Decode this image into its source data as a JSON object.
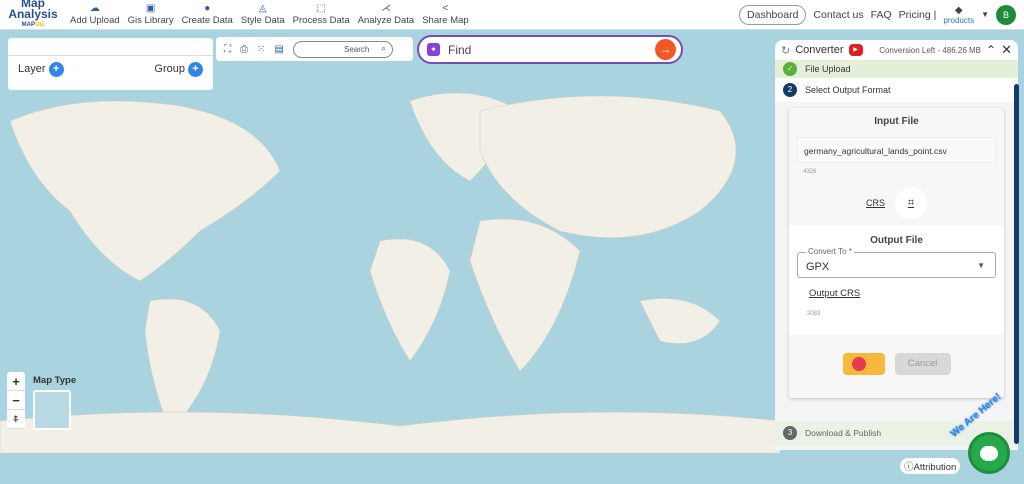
{
  "header": {
    "logo_title": "Map Analysis",
    "logo_sub": "MAPOG",
    "nav": [
      {
        "label": "Add Upload",
        "icon": "cloud-upload-icon"
      },
      {
        "label": "Gis Library",
        "icon": "library-icon"
      },
      {
        "label": "Create Data",
        "icon": "pin-icon"
      },
      {
        "label": "Style Data",
        "icon": "paint-icon"
      },
      {
        "label": "Process Data",
        "icon": "process-icon"
      },
      {
        "label": "Analyze Data",
        "icon": "analyze-icon"
      },
      {
        "label": "Share Map",
        "icon": "share-icon"
      }
    ],
    "dashboard": "Dashboard",
    "contact": "Contact us",
    "faq": "FAQ",
    "pricing": "Pricing |",
    "products": "products",
    "avatar": "B"
  },
  "layers": {
    "layer": "Layer",
    "group": "Group"
  },
  "toolbar": {
    "search_placeholder": "Search"
  },
  "find": {
    "placeholder": "Find"
  },
  "map": {
    "zoom_in": "+",
    "zoom_out": "−",
    "reset": "⍏",
    "map_type": "Map Type",
    "attribution": "Attribution"
  },
  "converter": {
    "title": "Converter",
    "conversion_left": "Conversion Left - 486.26 MB",
    "steps": [
      {
        "num": "✓",
        "label": "File Upload"
      },
      {
        "num": "2",
        "label": "Select Output Format"
      },
      {
        "num": "3",
        "label": "Download & Publish"
      }
    ],
    "input_title": "Input File",
    "file_name": "germany_agricultural_lands_point.csv",
    "input_crs_value": "4326",
    "crs_label": "CRS",
    "output_title": "Output File",
    "convert_to_label": "Convert To *",
    "convert_to_value": "GPX",
    "output_crs_label": "Output CRS",
    "output_crs_value": "2083",
    "cancel": "Cancel"
  },
  "chat": {
    "badge": "We Are Here!"
  },
  "colors": {
    "accent": "#2b5fa8",
    "find_border": "#7b4bb5",
    "find_go": "#f05a22",
    "convert_button": "#f6b73c",
    "chat": "#25a94a",
    "water": "#a9d3df",
    "land": "#f2efe6"
  }
}
